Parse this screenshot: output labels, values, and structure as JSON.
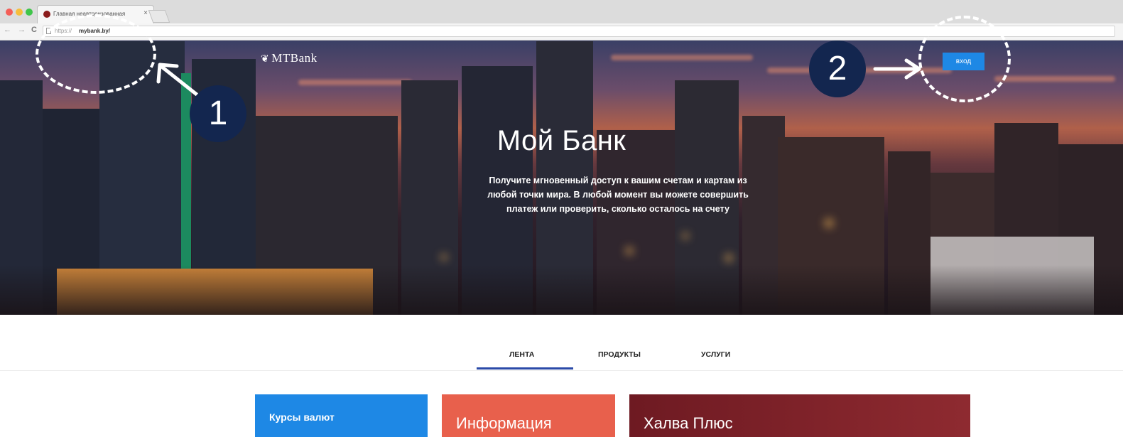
{
  "browser": {
    "tab_title": "Главная неавторизованная",
    "tab_close": "×",
    "back_icon": "←",
    "forward_icon": "→",
    "reload_icon": "C",
    "url_protocol": "https://",
    "url_host": "mybank.by/"
  },
  "header": {
    "logo_text": "MTBank",
    "login_label": "вход"
  },
  "hero": {
    "title": "Мой Банк",
    "description": "Получите мгновенный доступ к вашим счетам и картам из любой точки мира. В любой момент вы можете совершить платеж или проверить, сколько осталось на счету"
  },
  "annotations": {
    "badge1": "1",
    "badge2": "2"
  },
  "tabs": [
    {
      "label": "ЛЕНТА",
      "active": true
    },
    {
      "label": "ПРОДУКТЫ",
      "active": false
    },
    {
      "label": "УСЛУГИ",
      "active": false
    }
  ],
  "cards": [
    {
      "label": "Курсы валют",
      "color": "#1e88e5"
    },
    {
      "label": "Информация",
      "color": "#e8604c"
    },
    {
      "label": "Халва Плюс",
      "color": "#7a1c24"
    }
  ],
  "colors": {
    "accent": "#1e88e5",
    "badge": "#13264f",
    "tab_underline": "#2b4aa8"
  }
}
